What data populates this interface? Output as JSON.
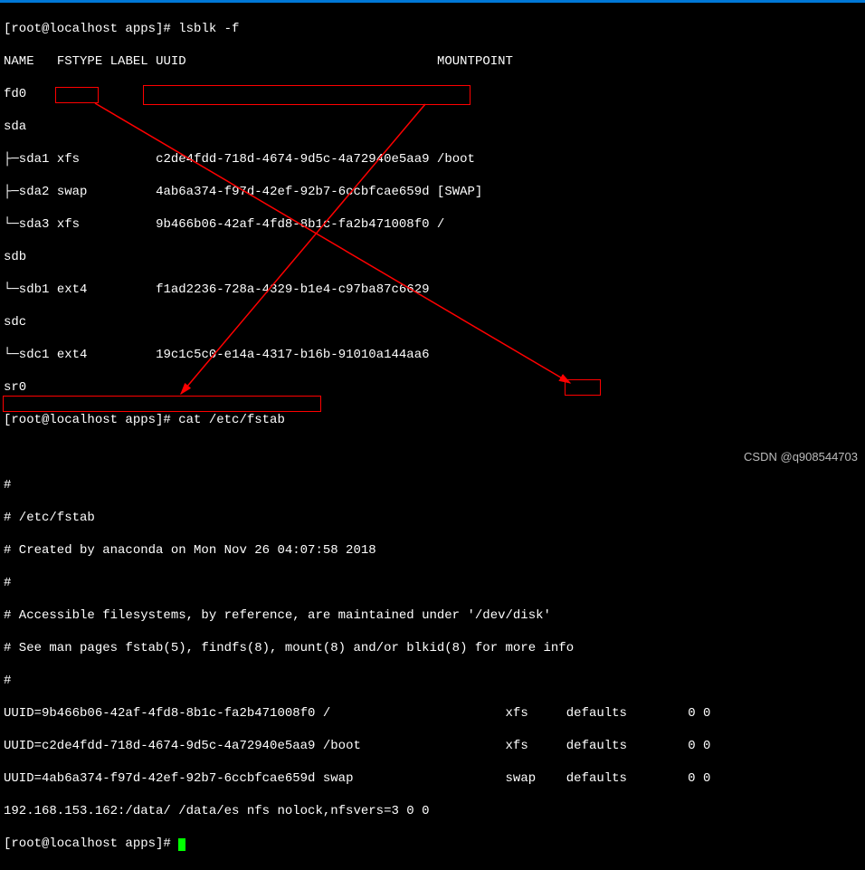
{
  "prompt": "[root@localhost apps]# ",
  "cmd1": "lsblk -f",
  "headers": {
    "name": "NAME",
    "fstype": "FSTYPE",
    "label": "LABEL",
    "uuid": "UUID",
    "mountpoint": "MOUNTPOINT"
  },
  "lsblk": {
    "fd0": "fd0",
    "sda": "sda",
    "sda1": {
      "tree": "├─sda1",
      "fstype": "xfs",
      "uuid": "c2de4fdd-718d-4674-9d5c-4a72940e5aa9",
      "mount": "/boot"
    },
    "sda2": {
      "tree": "├─sda2",
      "fstype": "swap",
      "uuid": "4ab6a374-f97d-42ef-92b7-6ccbfcae659d",
      "mount": "[SWAP]"
    },
    "sda3": {
      "tree": "└─sda3",
      "fstype": "xfs",
      "uuid": "9b466b06-42af-4fd8-8b1c-fa2b471008f0",
      "mount": "/"
    },
    "sdb": "sdb",
    "sdb1": {
      "tree": "└─sdb1",
      "fstype": "ext4",
      "uuid": "f1ad2236-728a-4329-b1e4-c97ba87c6629",
      "mount": ""
    },
    "sdc": "sdc",
    "sdc1": {
      "tree": "└─sdc1",
      "fstype": "ext4",
      "uuid": "19c1c5c0-e14a-4317-b16b-91010a144aa6",
      "mount": ""
    },
    "sr0": "sr0"
  },
  "cmd2": "cat /etc/fstab",
  "fstab": {
    "blank": "",
    "hash": "#",
    "title": "# /etc/fstab",
    "created": "# Created by anaconda on Mon Nov 26 04:07:58 2018",
    "acc": "# Accessible filesystems, by reference, are maintained under '/dev/disk'",
    "see": "# See man pages fstab(5), findfs(8), mount(8) and/or blkid(8) for more info",
    "r1": {
      "dev": "UUID=9b466b06-42af-4fd8-8b1c-fa2b471008f0",
      "mnt": "/",
      "fs": "xfs",
      "opt": "defaults",
      "d": "0 0"
    },
    "r2": {
      "dev": "UUID=c2de4fdd-718d-4674-9d5c-4a72940e5aa9",
      "mnt": "/boot",
      "fs": "xfs",
      "opt": "defaults",
      "d": "0 0"
    },
    "r3": {
      "dev": "UUID=4ab6a374-f97d-42ef-92b7-6ccbfcae659d",
      "mnt": "swap",
      "fs": "swap",
      "opt": "defaults",
      "d": "0 0"
    },
    "nfs": "192.168.153.162:/data/ /data/es nfs nolock,nfsvers=3 0 0"
  },
  "watermark": "CSDN @q908544703"
}
